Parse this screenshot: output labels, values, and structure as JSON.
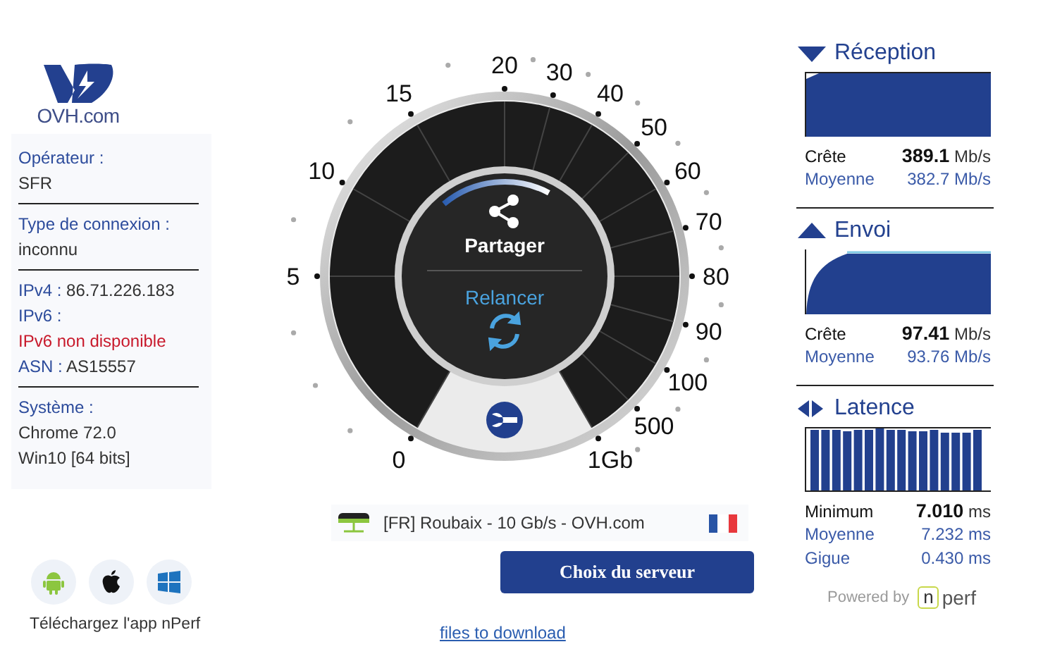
{
  "logo": {
    "text": "OVH.com"
  },
  "info_sections": [
    {
      "items": [
        {
          "kind": "label",
          "label": "Opérateur :"
        },
        {
          "kind": "value",
          "value": "SFR"
        }
      ]
    },
    {
      "items": [
        {
          "kind": "label",
          "label": "Type de connexion :"
        },
        {
          "kind": "value",
          "value": "inconnu"
        }
      ]
    },
    {
      "items": [
        {
          "kind": "inline",
          "label": "IPv4 :",
          "value": "86.71.226.183"
        },
        {
          "kind": "label",
          "label": "IPv6 :"
        },
        {
          "kind": "error",
          "value": "IPv6 non disponible"
        },
        {
          "kind": "inline",
          "label": "ASN :",
          "value": "AS15557"
        }
      ]
    },
    {
      "items": [
        {
          "kind": "label",
          "label": "Système :"
        },
        {
          "kind": "value",
          "value": "Chrome 72.0"
        },
        {
          "kind": "value",
          "value": "Win10 [64 bits]"
        }
      ]
    }
  ],
  "apps": [
    {
      "kind": "android"
    },
    {
      "kind": "apple"
    },
    {
      "kind": "windows"
    }
  ],
  "apps_caption": "Téléchargez l'app nPerf",
  "gauge": {
    "scale": [
      "0",
      "5",
      "10",
      "15",
      "20",
      "30",
      "40",
      "50",
      "60",
      "70",
      "80",
      "90",
      "100",
      "500",
      "1Gb"
    ],
    "share": "Partager",
    "restart": "Relancer"
  },
  "server": {
    "name": "[FR] Roubaix - 10 Gb/s - OVH.com"
  },
  "server_button": "Choix du serveur",
  "download_link": "files to download",
  "results": [
    {
      "kind": "down",
      "title": "Réception",
      "stats": [
        {
          "kind": "primary",
          "label": "Crête",
          "value": "389.1",
          "unit": "Mb/s"
        },
        {
          "kind": "secondary",
          "label": "Moyenne",
          "value": "382.7",
          "unit": "Mb/s"
        }
      ]
    },
    {
      "kind": "up",
      "title": "Envoi",
      "stats": [
        {
          "kind": "primary",
          "label": "Crête",
          "value": "97.41",
          "unit": "Mb/s"
        },
        {
          "kind": "secondary",
          "label": "Moyenne",
          "value": "93.76",
          "unit": "Mb/s"
        }
      ]
    },
    {
      "kind": "both",
      "title": "Latence",
      "stats": [
        {
          "kind": "primary",
          "label": "Minimum",
          "value": "7.010",
          "unit": "ms"
        },
        {
          "kind": "secondary",
          "label": "Moyenne",
          "value": "7.232",
          "unit": "ms"
        },
        {
          "kind": "secondary",
          "label": "Gigue",
          "value": "0.430",
          "unit": "ms"
        }
      ]
    }
  ],
  "powered_by": "Powered by",
  "nperf_logo": [
    "n",
    "perf"
  ]
}
